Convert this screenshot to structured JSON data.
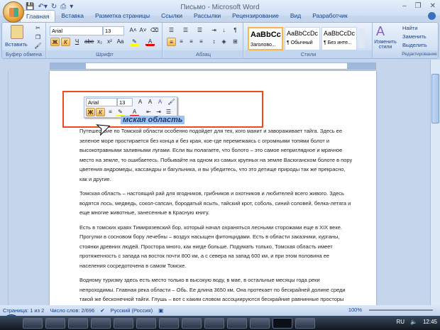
{
  "window": {
    "title": "Письмо - Microsoft Word"
  },
  "tabs": [
    "Главная",
    "Вставка",
    "Разметка страницы",
    "Ссылки",
    "Рассылки",
    "Рецензирование",
    "Вид",
    "Разработчик"
  ],
  "ribbon": {
    "clipboard": {
      "label": "Буфер обмена",
      "paste": "Вставить"
    },
    "font": {
      "label": "Шрифт",
      "name": "Arial",
      "size": "13",
      "bold": "Ж",
      "italic": "К",
      "underline": "Ч",
      "strike": "abe",
      "sub": "x₂",
      "sup": "x²",
      "case": "Aa",
      "grow": "A˄",
      "shrink": "A˅"
    },
    "paragraph": {
      "label": "Абзац",
      "pilcrow": "¶"
    },
    "styles": {
      "label": "Стили",
      "items": [
        {
          "sample": "AaBbCc",
          "name": "Заголово..."
        },
        {
          "sample": "AaBbCcDc",
          "name": "¶ Обычный"
        },
        {
          "sample": "AaBbCcDc",
          "name": "¶ Без инте..."
        }
      ],
      "change": "Изменить стили"
    },
    "editing": {
      "label": "Редактирование",
      "find": "Найти",
      "replace": "Заменить",
      "select": "Выделить"
    }
  },
  "mini_toolbar": {
    "font": "Arial",
    "size": "13",
    "bold": "Ж",
    "italic": "К"
  },
  "document": {
    "heading": "мская область",
    "paragraphs": [
      "Путешествие по Томской области особенно подойдет для тех, кого манит и завораживает тайга. Здесь ее зеленое море простирается без конца и без края, кое-где перемежаясь с огромными топями болот и высокотравными заливными лугами. Если вы полагаете, что болото – это самое неприглядное и мрачное место на земле, то ошибаетесь. Побывайте на одном из самых крупных на земле Васюганском болоте в пору цветения андромеды, кассандры и багульника, и вы убедитесь, что это детище природы так же прекрасно, как и другие.",
      "Томская область – настоящий рай для ягодников, грибников и охотников и любителей всего живого. Здесь водятся лось, медведь, сокол-сапсан, бородатый ясыть, тайский крот, соболь, синий соловей, белка-летяга и еще многие животные, занесенные в Красную книгу.",
      "Есть в томских краях Тимирязевский бор, который начал охраняться лесными сторожами еще в XIX веке. Прогулки в сосновом бору лечебны – воздух насыщен фитонцидами. Есть в области заказники, курганы, стоянки древних людей. Простора много, как нигде больше. Подумать только, Томская область имеет протяженность с запада на восток почти 800 км, а с севера на запад 600 км, и при этом половина ее населения сосредоточена в самом Томске.",
      "Водному туризму здесь есть место только в высокую воду, в мае, в остальные месяцы года реки непроходимы. Главная река области – Обь. Ее длина 3650 км. Она протекает по бескрайней долине среди такой же бесконечной тайги. Глушь – вот с каким словом ассоциируются бескрайние равнинные просторы Томской области. Здесь можно заплыть на остров, оказаться на просторном"
    ]
  },
  "status": {
    "page": "Страница: 1 из 2",
    "words": "Число слов: 2/696",
    "lang": "Русский (Россия)",
    "zoom": "100%"
  },
  "taskbar": {
    "lang": "RU",
    "time": "12:45"
  }
}
